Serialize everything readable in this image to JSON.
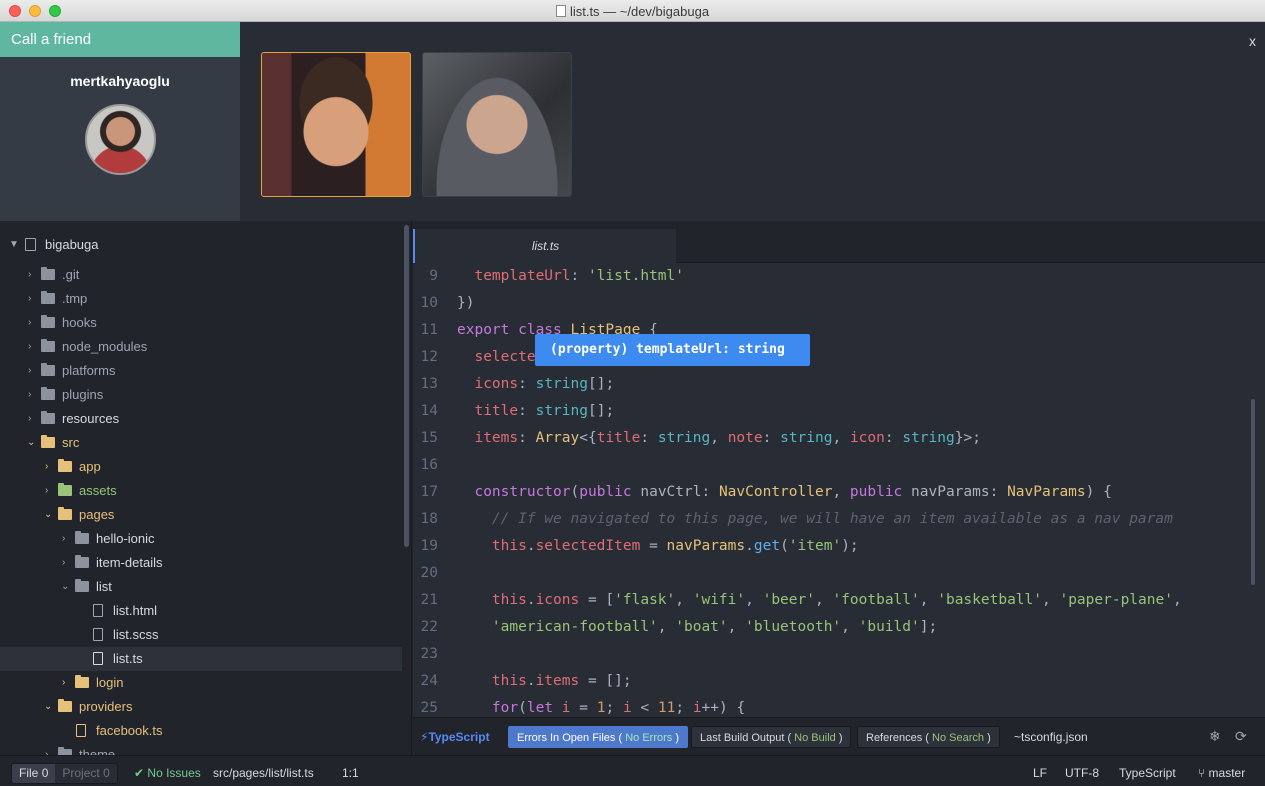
{
  "window": {
    "title": "list.ts — ~/dev/bigabuga"
  },
  "call": {
    "header": "Call a friend",
    "username": "mertkahyaoglu",
    "close_label": "x"
  },
  "tree": {
    "root": "bigabuga",
    "items": [
      {
        "label": ".git"
      },
      {
        "label": ".tmp"
      },
      {
        "label": "hooks"
      },
      {
        "label": "node_modules"
      },
      {
        "label": "platforms"
      },
      {
        "label": "plugins"
      },
      {
        "label": "resources"
      },
      {
        "label": "src"
      },
      {
        "label": "app"
      },
      {
        "label": "assets"
      },
      {
        "label": "pages"
      },
      {
        "label": "hello-ionic"
      },
      {
        "label": "item-details"
      },
      {
        "label": "list"
      },
      {
        "label": "list.html"
      },
      {
        "label": "list.scss"
      },
      {
        "label": "list.ts"
      },
      {
        "label": "login"
      },
      {
        "label": "providers"
      },
      {
        "label": "facebook.ts"
      },
      {
        "label": "theme"
      }
    ]
  },
  "editor": {
    "tab": "list.ts",
    "tooltip": "(property) templateUrl: string",
    "line_numbers": [
      "9",
      "10",
      "11",
      "12",
      "13",
      "14",
      "15",
      "16",
      "17",
      "18",
      "19",
      "20",
      "21",
      "22",
      "23",
      "24",
      "25"
    ]
  },
  "typescript_bar": {
    "logo": "TypeScript",
    "errors_label": "Errors In Open Files (",
    "errors_status": "No Errors",
    "build_label": "Last Build Output (",
    "build_status": "No Build",
    "refs_label": "References (",
    "refs_status": "No Search",
    "close_paren": ")",
    "config": "~tsconfig.json"
  },
  "statusbar": {
    "file_tab": "File",
    "file_count": "0",
    "project_tab": "Project",
    "project_count": "0",
    "issues": "No Issues",
    "path": "src/pages/list/list.ts",
    "cursor": "1:1",
    "line_ending": "LF",
    "encoding": "UTF-8",
    "grammar": "TypeScript",
    "branch": "master"
  }
}
